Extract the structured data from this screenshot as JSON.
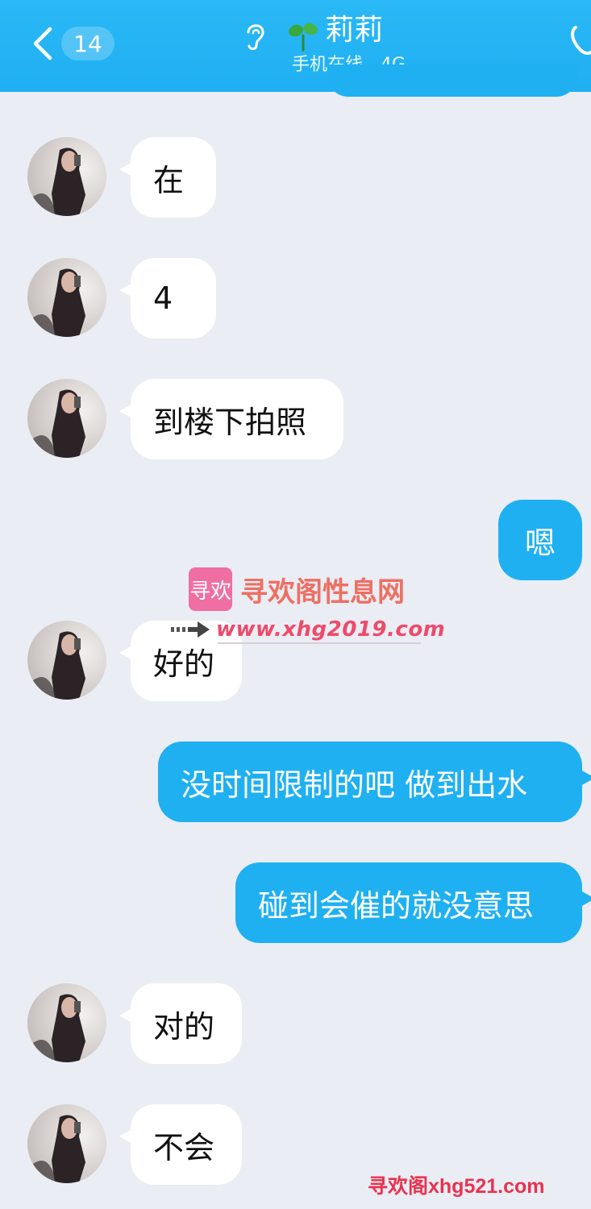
{
  "header": {
    "unread_count": "14",
    "contact_name": "莉莉",
    "status": "手机在线 - 4G",
    "colors": {
      "bar": "#1fb0f2",
      "text": "#ffffff"
    },
    "icons": [
      "back-chevron-icon",
      "ear-icon",
      "leaf-icon",
      "phone-icon"
    ]
  },
  "messages": [
    {
      "side": "left",
      "text": "在"
    },
    {
      "side": "left",
      "text": "4"
    },
    {
      "side": "left",
      "text": "到楼下拍照"
    },
    {
      "side": "right",
      "text": "嗯"
    },
    {
      "side": "left",
      "text": "好的"
    },
    {
      "side": "right",
      "text": "没时间限制的吧 做到出水"
    },
    {
      "side": "right",
      "text": "碰到会催的就没意思"
    },
    {
      "side": "left",
      "text": "对的"
    },
    {
      "side": "left",
      "text": "不会"
    }
  ],
  "watermark": {
    "logo_text": "寻欢",
    "title": "寻欢阁性息网",
    "url": "www.xhg2019.com",
    "bottom": "寻欢阁xhg521.com",
    "color": "#ee4a6a"
  },
  "colors": {
    "background": "#eaedf4",
    "incoming_bubble": "#ffffff",
    "outgoing_bubble": "#1fb0f2"
  }
}
